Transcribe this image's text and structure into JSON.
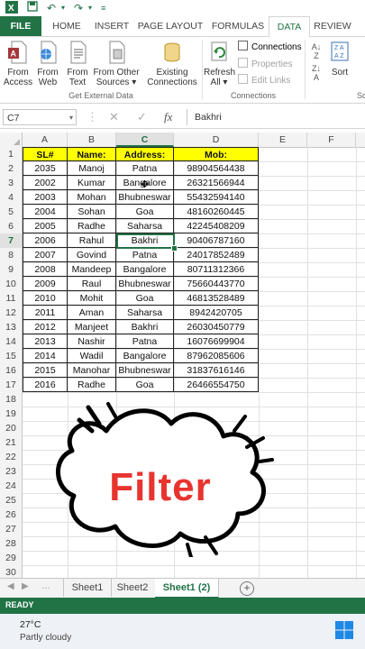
{
  "ribbon": {
    "tabs": [
      "FILE",
      "HOME",
      "INSERT",
      "PAGE LAYOUT",
      "FORMULAS",
      "DATA",
      "REVIEW"
    ],
    "active_tab": "DATA",
    "get_external_data": {
      "from_access": [
        "From",
        "Access"
      ],
      "from_web": [
        "From",
        "Web"
      ],
      "from_text": [
        "From",
        "Text"
      ],
      "from_other": [
        "From Other",
        "Sources ▾"
      ],
      "existing": [
        "Existing",
        "Connections"
      ],
      "label": "Get External Data"
    },
    "connections": {
      "refresh": [
        "Refresh",
        "All ▾"
      ],
      "connections": "Connections",
      "properties": "Properties",
      "edit_links": "Edit Links",
      "label": "Connections"
    },
    "sort": {
      "sort_label": "Sort",
      "group_label_partial": "So"
    }
  },
  "formula_bar": {
    "name_box": "C7",
    "content": "Bakhri"
  },
  "columns": [
    "A",
    "B",
    "C",
    "D",
    "E",
    "F"
  ],
  "selected_column": "C",
  "row_numbers": [
    "1",
    "2",
    "3",
    "4",
    "5",
    "6",
    "7",
    "8",
    "9",
    "10",
    "11",
    "12",
    "13",
    "14",
    "15",
    "16",
    "17",
    "18",
    "19",
    "20",
    "21",
    "22",
    "23",
    "24",
    "25",
    "26",
    "27",
    "28",
    "29",
    "30"
  ],
  "selected_row": "7",
  "table": {
    "headers": [
      "SL#",
      "Name:",
      "Address:",
      "Mob:"
    ],
    "rows": [
      [
        "2035",
        "Manoj",
        "Patna",
        "98904564438"
      ],
      [
        "2002",
        "Kumar",
        "Bangalore",
        "26321566944"
      ],
      [
        "2003",
        "Mohan",
        "Bhubneswar",
        "55432594140"
      ],
      [
        "2004",
        "Sohan",
        "Goa",
        "48160260445"
      ],
      [
        "2005",
        "Radhe",
        "Saharsa",
        "42245408209"
      ],
      [
        "2006",
        "Rahul",
        "Bakhri",
        "90406787160"
      ],
      [
        "2007",
        "Govind",
        "Patna",
        "24017852489"
      ],
      [
        "2008",
        "Mandeep",
        "Bangalore",
        "80711312366"
      ],
      [
        "2009",
        "Raul",
        "Bhubneswar",
        "75660443770"
      ],
      [
        "2010",
        "Mohit",
        "Goa",
        "46813528489"
      ],
      [
        "2011",
        "Aman",
        "Saharsa",
        "8942420705"
      ],
      [
        "2012",
        "Manjeet",
        "Bakhri",
        "26030450779"
      ],
      [
        "2013",
        "Nashir",
        "Patna",
        "16076699904"
      ],
      [
        "2014",
        "Wadil",
        "Bangalore",
        "87962085606"
      ],
      [
        "2015",
        "Manohar",
        "Bhubneswar",
        "31837616146"
      ],
      [
        "2016",
        "Radhe",
        "Goa",
        "26466554750"
      ]
    ]
  },
  "overlay_text": "Filter",
  "sheet_tabs": [
    "Sheet1",
    "Sheet2",
    "Sheet1 (2)"
  ],
  "active_sheet": "Sheet1 (2)",
  "status": "READY",
  "taskbar": {
    "temperature": "27°C",
    "weather": "Partly cloudy"
  },
  "colors": {
    "excel_green": "#217346",
    "header_fill": "#ffff00",
    "overlay_text": "#e8342f"
  }
}
